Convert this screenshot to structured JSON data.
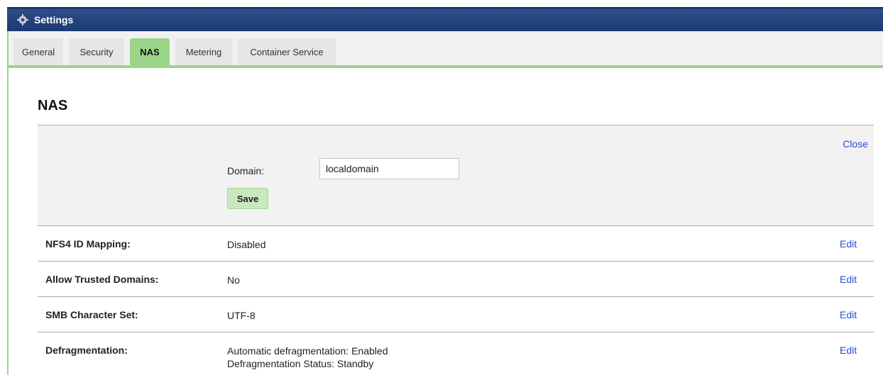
{
  "window": {
    "title": "Settings",
    "icon": "gear-icon"
  },
  "tabs": [
    {
      "label": "General"
    },
    {
      "label": "Security"
    },
    {
      "label": "NAS",
      "active": true
    },
    {
      "label": "Metering"
    },
    {
      "label": "Container Service"
    }
  ],
  "section": {
    "title": "NAS"
  },
  "domain_panel": {
    "close_label": "Close",
    "domain_label": "Domain:",
    "domain_value": "localdomain",
    "save_label": "Save"
  },
  "settings": [
    {
      "label": "NFS4 ID Mapping:",
      "value": "Disabled",
      "edit_label": "Edit"
    },
    {
      "label": "Allow Trusted Domains:",
      "value": "No",
      "edit_label": "Edit"
    },
    {
      "label": "SMB Character Set:",
      "value": "UTF-8",
      "edit_label": "Edit"
    },
    {
      "label": "Defragmentation:",
      "value_lines": [
        "Automatic defragmentation: Enabled",
        "Defragmentation Status: Standby"
      ],
      "edit_label": "Edit"
    }
  ],
  "colors": {
    "titlebar": "#1c3a72",
    "accent_green": "#9ad58a",
    "link": "#2a4bd8"
  }
}
